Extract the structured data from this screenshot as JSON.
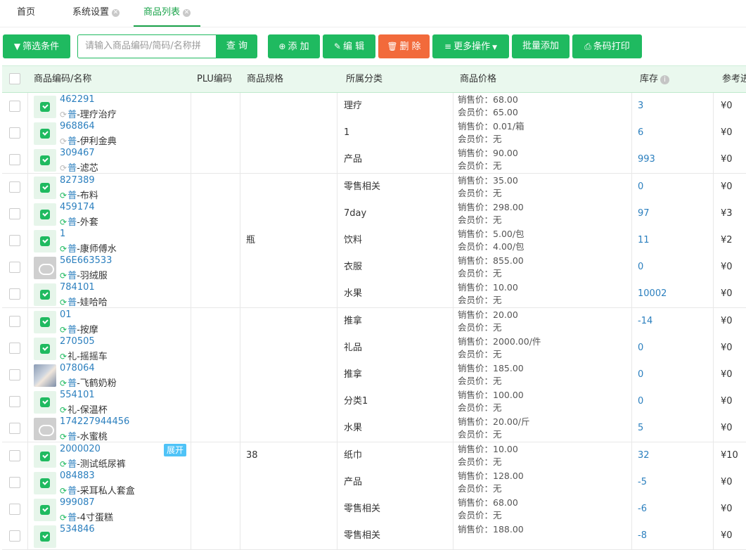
{
  "tabs": [
    {
      "label": "首页",
      "closable": false
    },
    {
      "label": "系统设置",
      "closable": true
    },
    {
      "label": "商品列表",
      "closable": true,
      "active": true
    }
  ],
  "toolbar": {
    "filter_label": "筛选条件",
    "search_placeholder": "请输入商品编码/简码/名称拼",
    "query_label": "查 询",
    "add_label": "添 加",
    "edit_label": "编 辑",
    "delete_label": "删 除",
    "more_label": "更多操作",
    "batch_add_label": "批量添加",
    "barcode_print_label": "条码打印"
  },
  "table": {
    "headers": {
      "code_name": "商品编码/名称",
      "plu": "PLU编码",
      "spec": "商品规格",
      "category": "所属分类",
      "price": "商品价格",
      "stock": "库存",
      "ref": "参考进"
    },
    "sale_prefix": "销售价：",
    "member_prefix": "会员价：",
    "expand_label": "展开",
    "rows": [
      {
        "code": "462291",
        "tag": "普",
        "name": "-理疗治疗",
        "sync": "grey",
        "thumb": "green",
        "spec": "",
        "category": "理疗",
        "sale": "68.00",
        "member": "65.00",
        "stock": "3",
        "ref": "¥0"
      },
      {
        "code": "968864",
        "tag": "普",
        "name": "-伊利金典",
        "sync": "grey",
        "thumb": "green",
        "spec": "",
        "category": "1",
        "sale": "0.01/箱",
        "member": "无",
        "stock": "6",
        "ref": "¥0"
      },
      {
        "code": "309467",
        "tag": "普",
        "name": "-滤芯",
        "sync": "grey",
        "thumb": "green",
        "spec": "",
        "category": "产品",
        "sale": "90.00",
        "member": "无",
        "stock": "993",
        "ref": "¥0"
      },
      {
        "code": "827389",
        "tag": "普",
        "name": "-布料",
        "sync": "green",
        "thumb": "green",
        "spec": "",
        "category": "零售相关",
        "sale": "35.00",
        "member": "无",
        "stock": "0",
        "ref": "¥0"
      },
      {
        "code": "459174",
        "tag": "普",
        "name": "-外套",
        "sync": "green",
        "thumb": "green",
        "spec": "",
        "category": "7day",
        "sale": "298.00",
        "member": "无",
        "stock": "97",
        "ref": "¥3"
      },
      {
        "code": "1",
        "tag": "普",
        "name": "-康师傅水",
        "sync": "green",
        "thumb": "green",
        "spec": "瓶",
        "category": "饮料",
        "sale": "5.00/包",
        "member": "4.00/包",
        "stock": "11",
        "ref": "¥2"
      },
      {
        "code": "56E663533",
        "tag": "普",
        "name": "-羽绒服",
        "sync": "green",
        "thumb": "cloud",
        "spec": "",
        "category": "衣服",
        "sale": "855.00",
        "member": "无",
        "stock": "0",
        "ref": "¥0"
      },
      {
        "code": "784101",
        "tag": "普",
        "name": "-娃哈哈",
        "sync": "green",
        "thumb": "green",
        "spec": "",
        "category": "水果",
        "sale": "10.00",
        "member": "无",
        "stock": "10002",
        "ref": "¥0"
      },
      {
        "code": "01",
        "tag": "普",
        "name": "-按摩",
        "sync": "green",
        "thumb": "green",
        "spec": "",
        "category": "推拿",
        "sale": "20.00",
        "member": "无",
        "stock": "-14",
        "ref": "¥0"
      },
      {
        "code": "270505",
        "tag": "礼",
        "name": "-摇摇车",
        "sync": "green",
        "thumb": "green",
        "spec": "",
        "category": "礼品",
        "sale": "2000.00/件",
        "member": "无",
        "stock": "0",
        "ref": "¥0"
      },
      {
        "code": "078064",
        "tag": "普",
        "name": "-飞鹤奶粉",
        "sync": "green",
        "thumb": "photo",
        "spec": "",
        "category": "推拿",
        "sale": "185.00",
        "member": "无",
        "stock": "0",
        "ref": "¥0"
      },
      {
        "code": "554101",
        "tag": "礼",
        "name": "-保温杯",
        "sync": "green",
        "thumb": "green",
        "spec": "",
        "category": "分类1",
        "sale": "100.00",
        "member": "无",
        "stock": "0",
        "ref": "¥0"
      },
      {
        "code": "174227944456",
        "tag": "普",
        "name": "-水蜜桃",
        "sync": "green",
        "thumb": "cloud",
        "spec": "",
        "category": "水果",
        "sale": "20.00/斤",
        "member": "无",
        "stock": "5",
        "ref": "¥0"
      },
      {
        "code": "2000020",
        "tag": "普",
        "name": "-测试纸尿裤",
        "sync": "green",
        "thumb": "green",
        "spec": "38",
        "category": "纸巾",
        "sale": "10.00",
        "member": "无",
        "stock": "32",
        "ref": "¥10",
        "expand": true
      },
      {
        "code": "084883",
        "tag": "普",
        "name": "-采耳私人套盒",
        "sync": "green",
        "thumb": "green",
        "spec": "",
        "category": "产品",
        "sale": "128.00",
        "member": "无",
        "stock": "-5",
        "ref": "¥0"
      },
      {
        "code": "999087",
        "tag": "普",
        "name": "-4寸蛋糕",
        "sync": "green",
        "thumb": "green",
        "spec": "",
        "category": "零售相关",
        "sale": "68.00",
        "member": "无",
        "stock": "-6",
        "ref": "¥0"
      },
      {
        "code": "534846",
        "tag": "",
        "name": "",
        "sync": "none",
        "thumb": "green",
        "spec": "",
        "category": "零售相关",
        "sale": "188.00",
        "member": "",
        "stock": "-8",
        "ref": "¥0"
      }
    ]
  }
}
